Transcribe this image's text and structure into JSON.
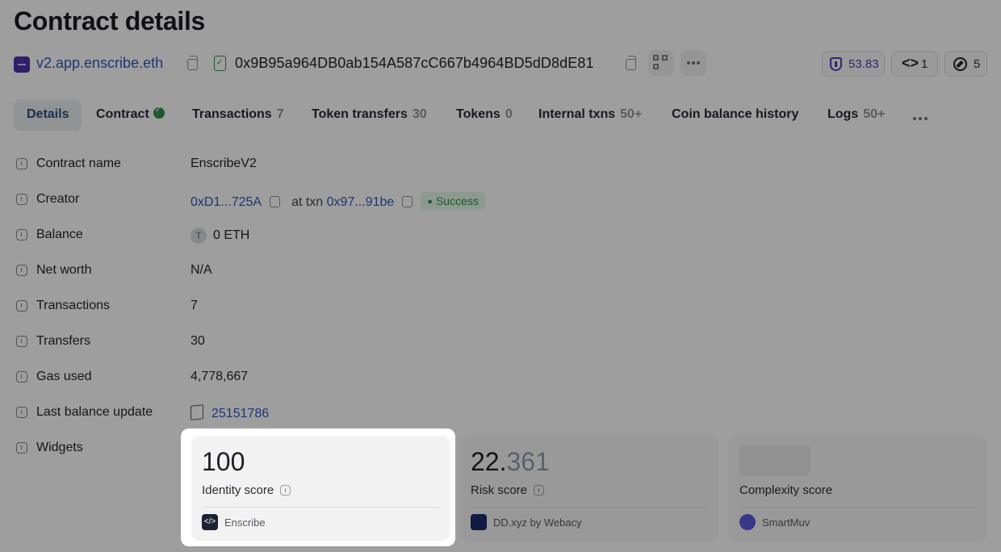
{
  "page": {
    "title": "Contract details"
  },
  "address_bar": {
    "ens_name": "v2.app.enscribe.eth",
    "contract_address": "0x9B95a964DB0ab154A587cC667b4964BD5dD8dE81",
    "pills": [
      {
        "icon": "shield-icon",
        "value": "53.83"
      },
      {
        "icon": "code-icon",
        "value": "1"
      },
      {
        "icon": "compass-icon",
        "value": "5"
      }
    ]
  },
  "tabs": [
    {
      "label": "Details",
      "count": "",
      "active": true
    },
    {
      "label": "Contract",
      "count": "",
      "verified": true
    },
    {
      "label": "Transactions",
      "count": "7"
    },
    {
      "label": "Token transfers",
      "count": "30"
    },
    {
      "label": "Tokens",
      "count": "0"
    },
    {
      "label": "Internal txns",
      "count": "50+"
    },
    {
      "label": "Coin balance history",
      "count": ""
    },
    {
      "label": "Logs",
      "count": "50+"
    }
  ],
  "details": {
    "contract_name": {
      "label": "Contract name",
      "value": "EnscribeV2"
    },
    "creator": {
      "label": "Creator",
      "address": "0xD1...725A",
      "at_txn": "at txn",
      "txn": "0x97...91be",
      "status": "Success"
    },
    "balance": {
      "label": "Balance",
      "token_letter": "T",
      "value": "0 ETH"
    },
    "net_worth": {
      "label": "Net worth",
      "value": "N/A"
    },
    "transactions": {
      "label": "Transactions",
      "value": "7"
    },
    "transfers": {
      "label": "Transfers",
      "value": "30"
    },
    "gas_used": {
      "label": "Gas used",
      "value": "4,778,667"
    },
    "last_balance_update": {
      "label": "Last balance update",
      "value": "25151786"
    },
    "widgets": {
      "label": "Widgets"
    }
  },
  "widgets": [
    {
      "score": "100",
      "score_dim": "",
      "label": "Identity score",
      "source": "Enscribe",
      "highlighted": true
    },
    {
      "score": "22.",
      "score_dim": "361",
      "label": "Risk score",
      "source": "DD.xyz by Webacy"
    },
    {
      "score": "",
      "score_dim": "",
      "label": "Complexity score",
      "source": "SmartMuv",
      "loading": true
    }
  ],
  "colors": {
    "accent": "#2c55b8",
    "success": "#2f8b49",
    "shield": "#4c3bb0"
  }
}
